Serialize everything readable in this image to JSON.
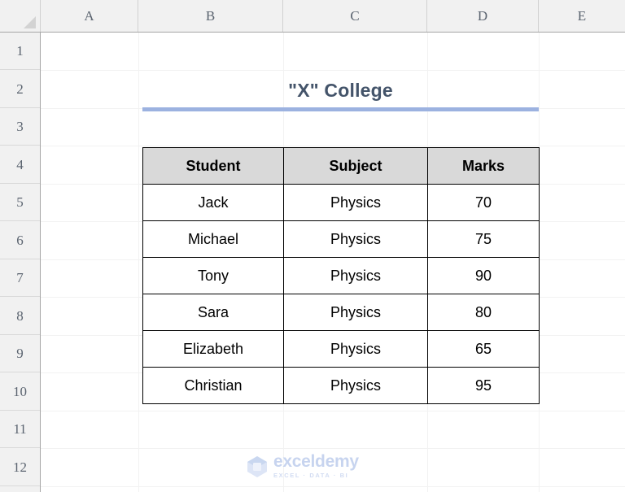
{
  "app": {
    "type": "spreadsheet"
  },
  "grid": {
    "column_headers": [
      "A",
      "B",
      "C",
      "D",
      "E"
    ],
    "row_headers": [
      "1",
      "2",
      "3",
      "4",
      "5",
      "6",
      "7",
      "8",
      "9",
      "10",
      "11",
      "12"
    ],
    "select_all_icon": "select-all-triangle"
  },
  "sheet_content": {
    "title": "\"X\" College",
    "title_color": "#44546a",
    "title_rule_color": "#9cb2e0",
    "table": {
      "header_bg": "#d9d9d9",
      "border_color": "#000000",
      "columns": [
        "Student",
        "Subject",
        "Marks"
      ],
      "rows": [
        {
          "student": "Jack",
          "subject": "Physics",
          "marks": "70"
        },
        {
          "student": "Michael",
          "subject": "Physics",
          "marks": "75"
        },
        {
          "student": "Tony",
          "subject": "Physics",
          "marks": "90"
        },
        {
          "student": "Sara",
          "subject": "Physics",
          "marks": "80"
        },
        {
          "student": "Elizabeth",
          "subject": "Physics",
          "marks": "65"
        },
        {
          "student": "Christian",
          "subject": "Physics",
          "marks": "95"
        }
      ]
    }
  },
  "watermark": {
    "name": "exceldemy",
    "tagline": "EXCEL · DATA · BI",
    "color": "#c7d4ef",
    "logo_icon": "exceldemy-cube-logo"
  }
}
